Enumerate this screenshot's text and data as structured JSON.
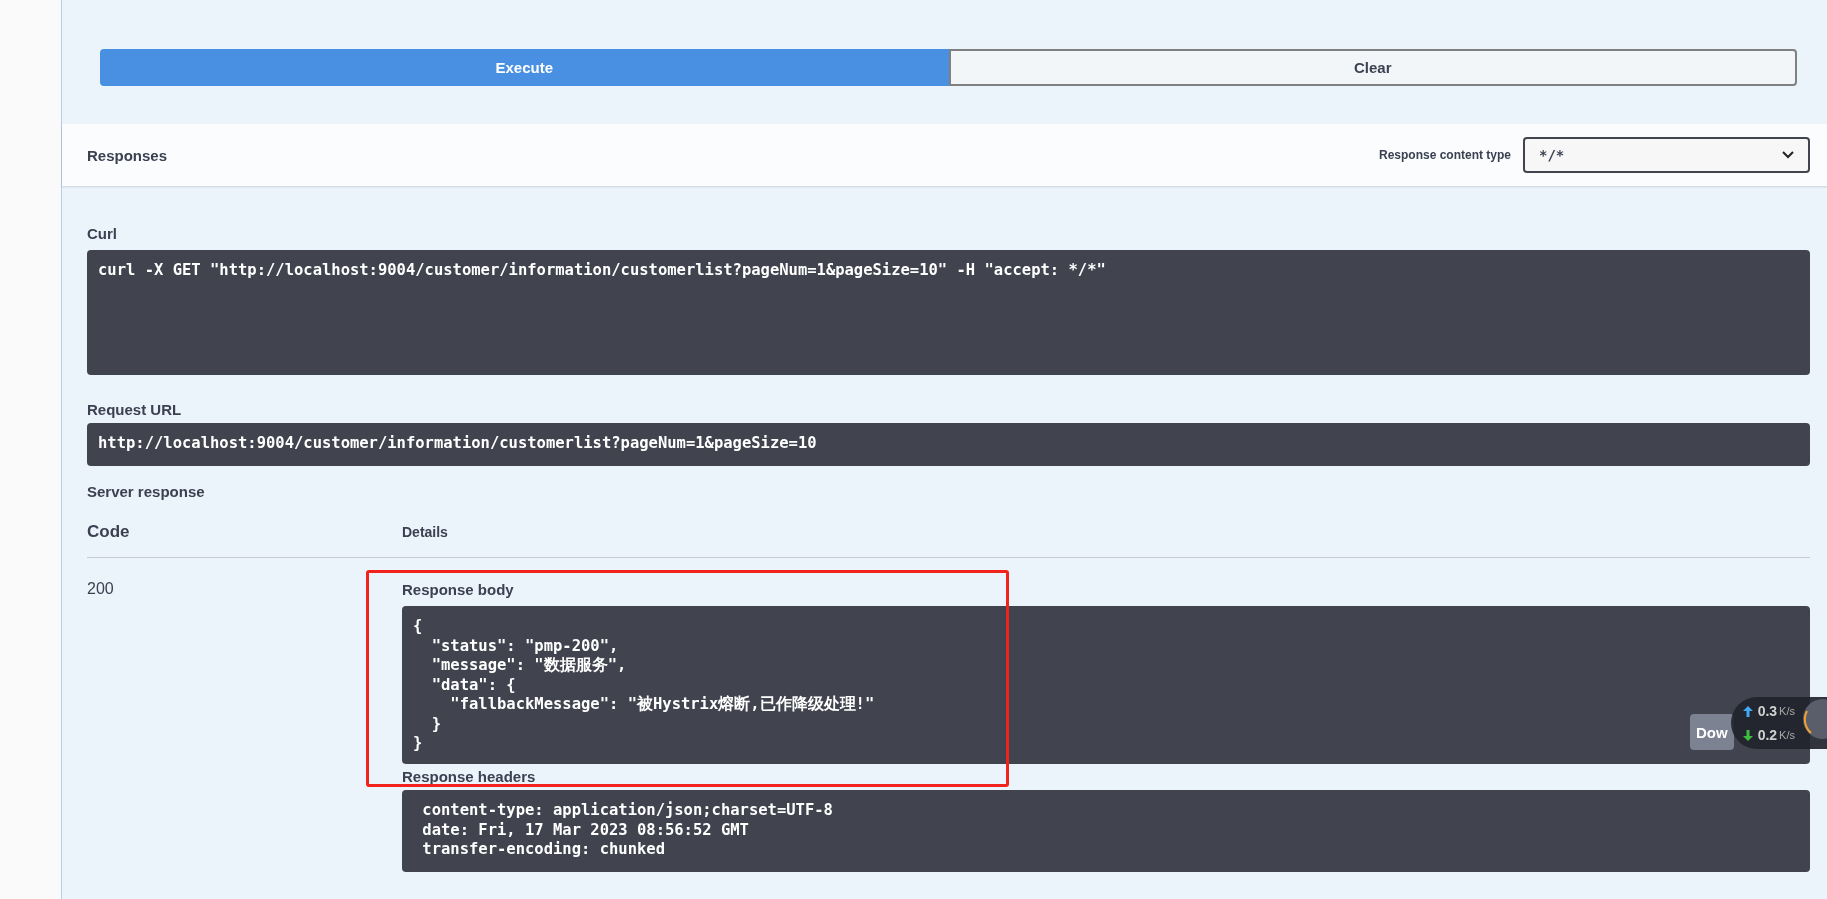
{
  "actions": [
    {
      "label": "Execute",
      "kind": "primary"
    },
    {
      "label": "Clear",
      "kind": "secondary"
    }
  ],
  "responses_header": {
    "title": "Responses",
    "content_type_label": "Response content type",
    "content_type_value": "*/*"
  },
  "curl": {
    "label": "Curl",
    "code": "curl -X GET \"http://localhost:9004/customer/information/customerlist?pageNum=1&pageSize=10\" -H \"accept: */*\""
  },
  "request_url": {
    "label": "Request URL",
    "code": "http://localhost:9004/customer/information/customerlist?pageNum=1&pageSize=10"
  },
  "server_response": {
    "label": "Server response",
    "columns": [
      "Code",
      "Details"
    ],
    "rows": [
      {
        "code": "200",
        "body": {
          "label": "Response body",
          "code": "{\n  \"status\": \"pmp-200\",\n  \"message\": \"数据服务\",\n  \"data\": {\n    \"fallbackMessage\": \"被Hystrix熔断,已作降级处理!\"\n  }\n}",
          "download_button": "Dow"
        },
        "headers": {
          "label": "Response headers",
          "code": " content-type: application/json;charset=UTF-8\n date: Fri, 17 Mar 2023 08:56:52 GMT\n transfer-encoding: chunked"
        }
      }
    ]
  },
  "speed_widget": [
    {
      "kind": "upload",
      "value": "0.3",
      "unit": "K/s"
    },
    {
      "kind": "download",
      "value": "0.2",
      "unit": "K/s"
    }
  ]
}
